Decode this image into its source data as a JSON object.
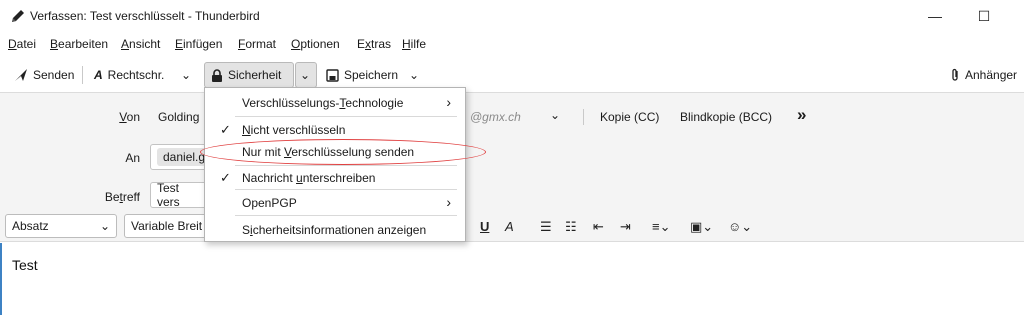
{
  "window": {
    "title": "Verfassen: Test verschlüsselt - Thunderbird",
    "minimize": "—",
    "maximize": "☐"
  },
  "menubar": {
    "items": [
      {
        "u": "D",
        "rest": "atei"
      },
      {
        "u": "B",
        "rest": "earbeiten"
      },
      {
        "u": "A",
        "rest": "nsicht"
      },
      {
        "u": "E",
        "rest": "infügen"
      },
      {
        "u": "F",
        "rest": "ormat"
      },
      {
        "u": "O",
        "rest": "ptionen"
      },
      {
        "pre": "E",
        "u": "x",
        "rest": "tras"
      },
      {
        "u": "H",
        "rest": "ilfe"
      }
    ]
  },
  "toolbar": {
    "send": "Senden",
    "spell": "Rechtschr.",
    "security": "Sicherheit",
    "save": "Speichern",
    "attach": "Anhänger"
  },
  "header": {
    "from_label_u": "V",
    "from_label_rest": "on",
    "from_value": "Golding",
    "from_domain": "@gmx.ch",
    "cc": "Kopie (CC)",
    "bcc": "Blindkopie (BCC)",
    "more": "»",
    "to_label": "An",
    "to_value": "daniel.g",
    "subject_label_pre": "Be",
    "subject_label_u": "t",
    "subject_label_rest": "reff",
    "subject_value": "Test vers"
  },
  "formatbar": {
    "paragraph": "Absatz",
    "font": "Variable Breit"
  },
  "body": {
    "text": "Test"
  },
  "security_menu": {
    "item1_pre": "Verschlüsselungs-",
    "item1_u": "T",
    "item1_rest": "echnologie",
    "item2_u": "N",
    "item2_rest": "icht verschlüsseln",
    "item3_pre": "Nur mit ",
    "item3_u": "V",
    "item3_rest": "erschlüsselung senden",
    "item4_pre": "Nachricht ",
    "item4_u": "u",
    "item4_rest": "nterschreiben",
    "item5": "OpenPGP",
    "item6_pre": "S",
    "item6_u": "i",
    "item6_rest": "cherheitsinformationen anzeigen",
    "check": "✓",
    "submenu_arrow": "›"
  },
  "colors": {
    "accent": "#3d82c4",
    "highlight_ellipse": "#e04040",
    "toolbar_bg": "#ffffff",
    "pane_bg": "#f4f4f4"
  }
}
